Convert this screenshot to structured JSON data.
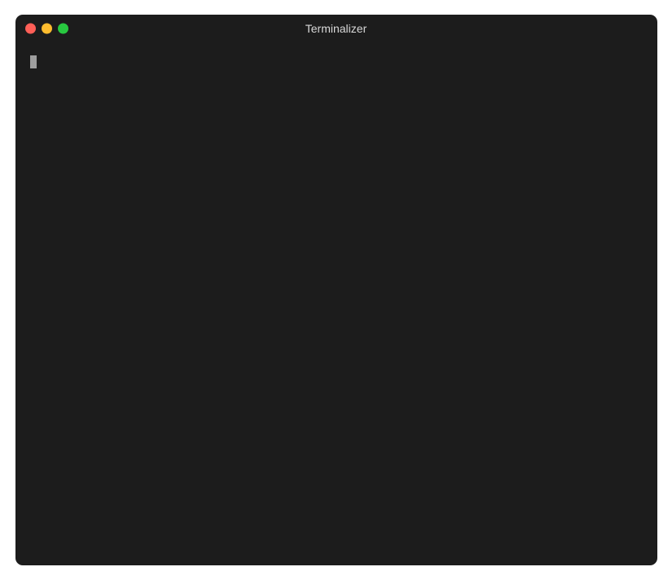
{
  "window": {
    "title": "Terminalizer"
  },
  "terminal": {
    "content": ""
  }
}
